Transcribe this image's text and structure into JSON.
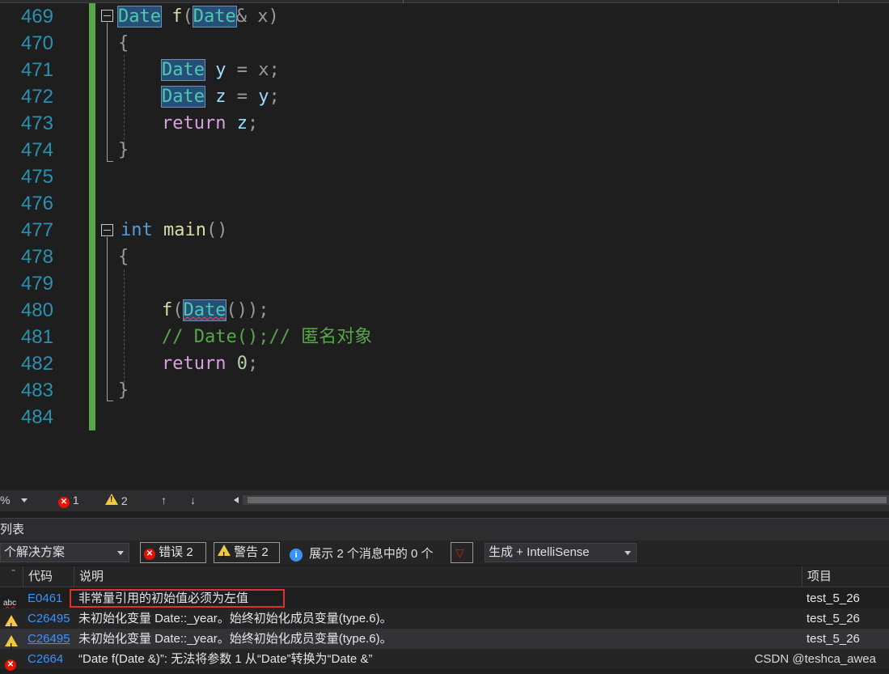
{
  "editor": {
    "lines": [
      {
        "n": "469"
      },
      {
        "n": "470"
      },
      {
        "n": "471"
      },
      {
        "n": "472"
      },
      {
        "n": "473"
      },
      {
        "n": "474"
      },
      {
        "n": "475"
      },
      {
        "n": "476"
      },
      {
        "n": "477"
      },
      {
        "n": "478"
      },
      {
        "n": "479"
      },
      {
        "n": "480"
      },
      {
        "n": "481"
      },
      {
        "n": "482"
      },
      {
        "n": "483"
      },
      {
        "n": "484"
      }
    ],
    "tokens": {
      "date": "Date",
      "f": "f",
      "x": "x",
      "y": "y",
      "z": "z",
      "return_kw": "return",
      "int_kw": "int",
      "main": "main",
      "zero": "0",
      "comment": "// Date();// 匿名对象"
    }
  },
  "status": {
    "zoom": "%",
    "errors": "1",
    "warnings": "2",
    "up": "↑",
    "down": "↓"
  },
  "error_list": {
    "title": "列表",
    "scope": "个解决方案",
    "errors_btn": "错误 2",
    "warnings_btn": "警告 2",
    "messages_btn": "展示 2 个消息中的 0 个",
    "build_filter": "生成 + IntelliSense",
    "columns": {
      "code": "代码",
      "desc": "说明",
      "project": "项目"
    },
    "rows": [
      {
        "type": "abc",
        "code": "E0461",
        "desc": "非常量引用的初始值必须为左值",
        "project": "test_5_26"
      },
      {
        "type": "warning",
        "code": "C26495",
        "desc": "未初始化变量 Date::_year。始终初始化成员变量(type.6)。",
        "project": "test_5_26"
      },
      {
        "type": "warning",
        "code": "C26495",
        "desc": "未初始化变量 Date::_year。始终初始化成员变量(type.6)。",
        "project": "test_5_26"
      },
      {
        "type": "error",
        "code": "C2664",
        "desc": "“Date f(Date &)”: 无法将参数 1 从“Date”转换为“Date &”",
        "project": ""
      }
    ]
  },
  "watermark": "CSDN @teshca_awea",
  "colors": {
    "accent": "#2b91af",
    "error": "#e51400",
    "warning": "#f2c744",
    "gutter_changed": "#57a64a"
  }
}
